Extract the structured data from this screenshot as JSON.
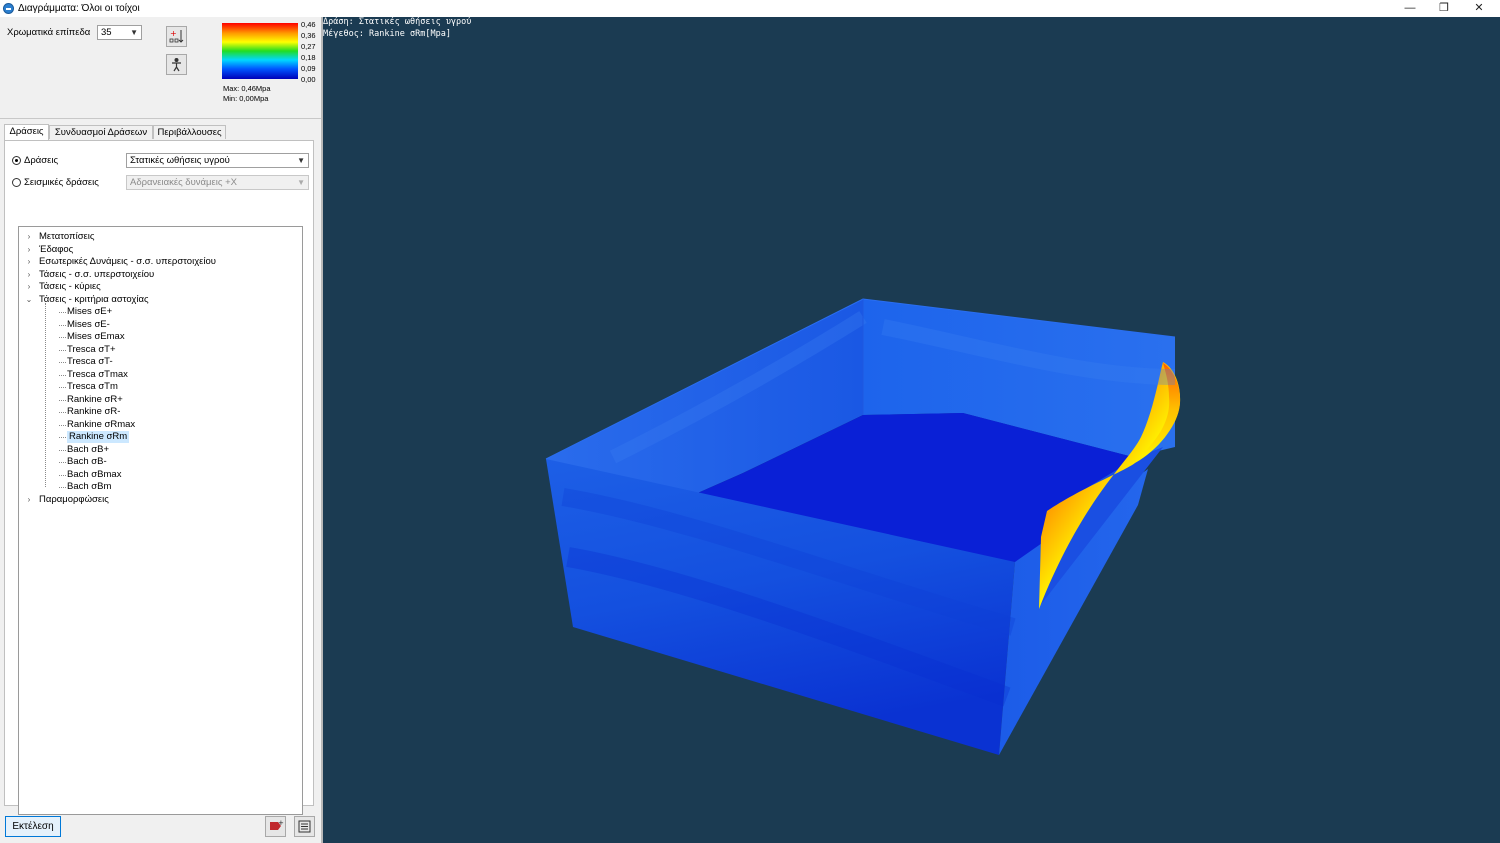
{
  "window": {
    "title": "Διαγράμματα: Όλοι οι τοίχοι",
    "minimize_glyph": "—",
    "restore_glyph": "❐",
    "close_glyph": "✕"
  },
  "top": {
    "levels_label": "Χρωματικά επίπεδα",
    "levels_value": "35",
    "legend": {
      "ticks": [
        "0,46",
        "0,36",
        "0,27",
        "0,18",
        "0,09",
        "0,00"
      ],
      "max_text": "Max: 0,46Mpa",
      "min_text": "Min: 0,00Mpa",
      "colors": [
        "#ff0000",
        "#ffff00",
        "#22dd22",
        "#00d8ff",
        "#0000b8"
      ]
    }
  },
  "tabs": [
    "Δράσεις",
    "Συνδυασμοί Δράσεων",
    "Περιβάλλουσες"
  ],
  "actions": {
    "radio1_label": "Δράσεις",
    "radio1_value": "Στατικές ωθήσεις υγρού",
    "radio2_label": "Σεισμικές δράσεις",
    "radio2_value": "Αδρανειακές δυνάμεις +X"
  },
  "tree": {
    "top_groups_before": [
      "Μετατοπίσεις",
      "Έδαφος",
      "Εσωτερικές Δυνάμεις - σ.σ. υπερστοιχείου",
      "Τάσεις - σ.σ. υπερστοιχείου",
      "Τάσεις - κύριες"
    ],
    "expanded_group": "Τάσεις - κριτήρια αστοχίας",
    "leaves": [
      "Mises σE+",
      "Mises σE-",
      "Mises σEmax",
      "Tresca σT+",
      "Tresca σT-",
      "Tresca σTmax",
      "Tresca σTm",
      "Rankine σR+",
      "Rankine σR-",
      "Rankine σRmax",
      "Rankine σRm",
      "Bach σB+",
      "Bach σB-",
      "Bach σBmax",
      "Bach σBm"
    ],
    "selected_leaf": "Rankine σRm",
    "last_group": "Παραμορφώσεις"
  },
  "footer": {
    "run_label": "Εκτέλεση"
  },
  "viewport": {
    "line1": "Δράση: Στατικές ωθήσεις υγρού",
    "line2": "Μέγεθος: Rankine σRm[Mpa]",
    "background": "#1b3b52"
  }
}
